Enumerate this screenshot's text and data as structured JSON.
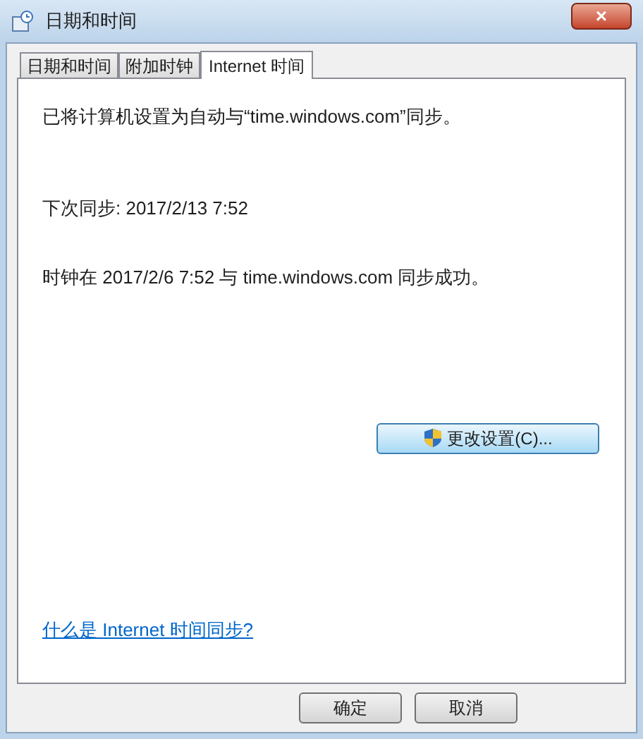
{
  "window": {
    "title": "日期和时间",
    "close": "×"
  },
  "tabs": [
    {
      "label": "日期和时间",
      "selected": false
    },
    {
      "label": "附加时钟",
      "selected": false
    },
    {
      "label": "Internet 时间",
      "selected": true
    }
  ],
  "panel": {
    "status": "已将计算机设置为自动与“time.windows.com”同步。",
    "next_sync": "下次同步: 2017/2/13 7:52",
    "last_sync": "时钟在 2017/2/6 7:52 与 time.windows.com 同步成功。",
    "change_button": "更改设置(C)...",
    "help_link": "什么是 Internet 时间同步?"
  },
  "buttons": [
    "确定",
    "取消"
  ]
}
